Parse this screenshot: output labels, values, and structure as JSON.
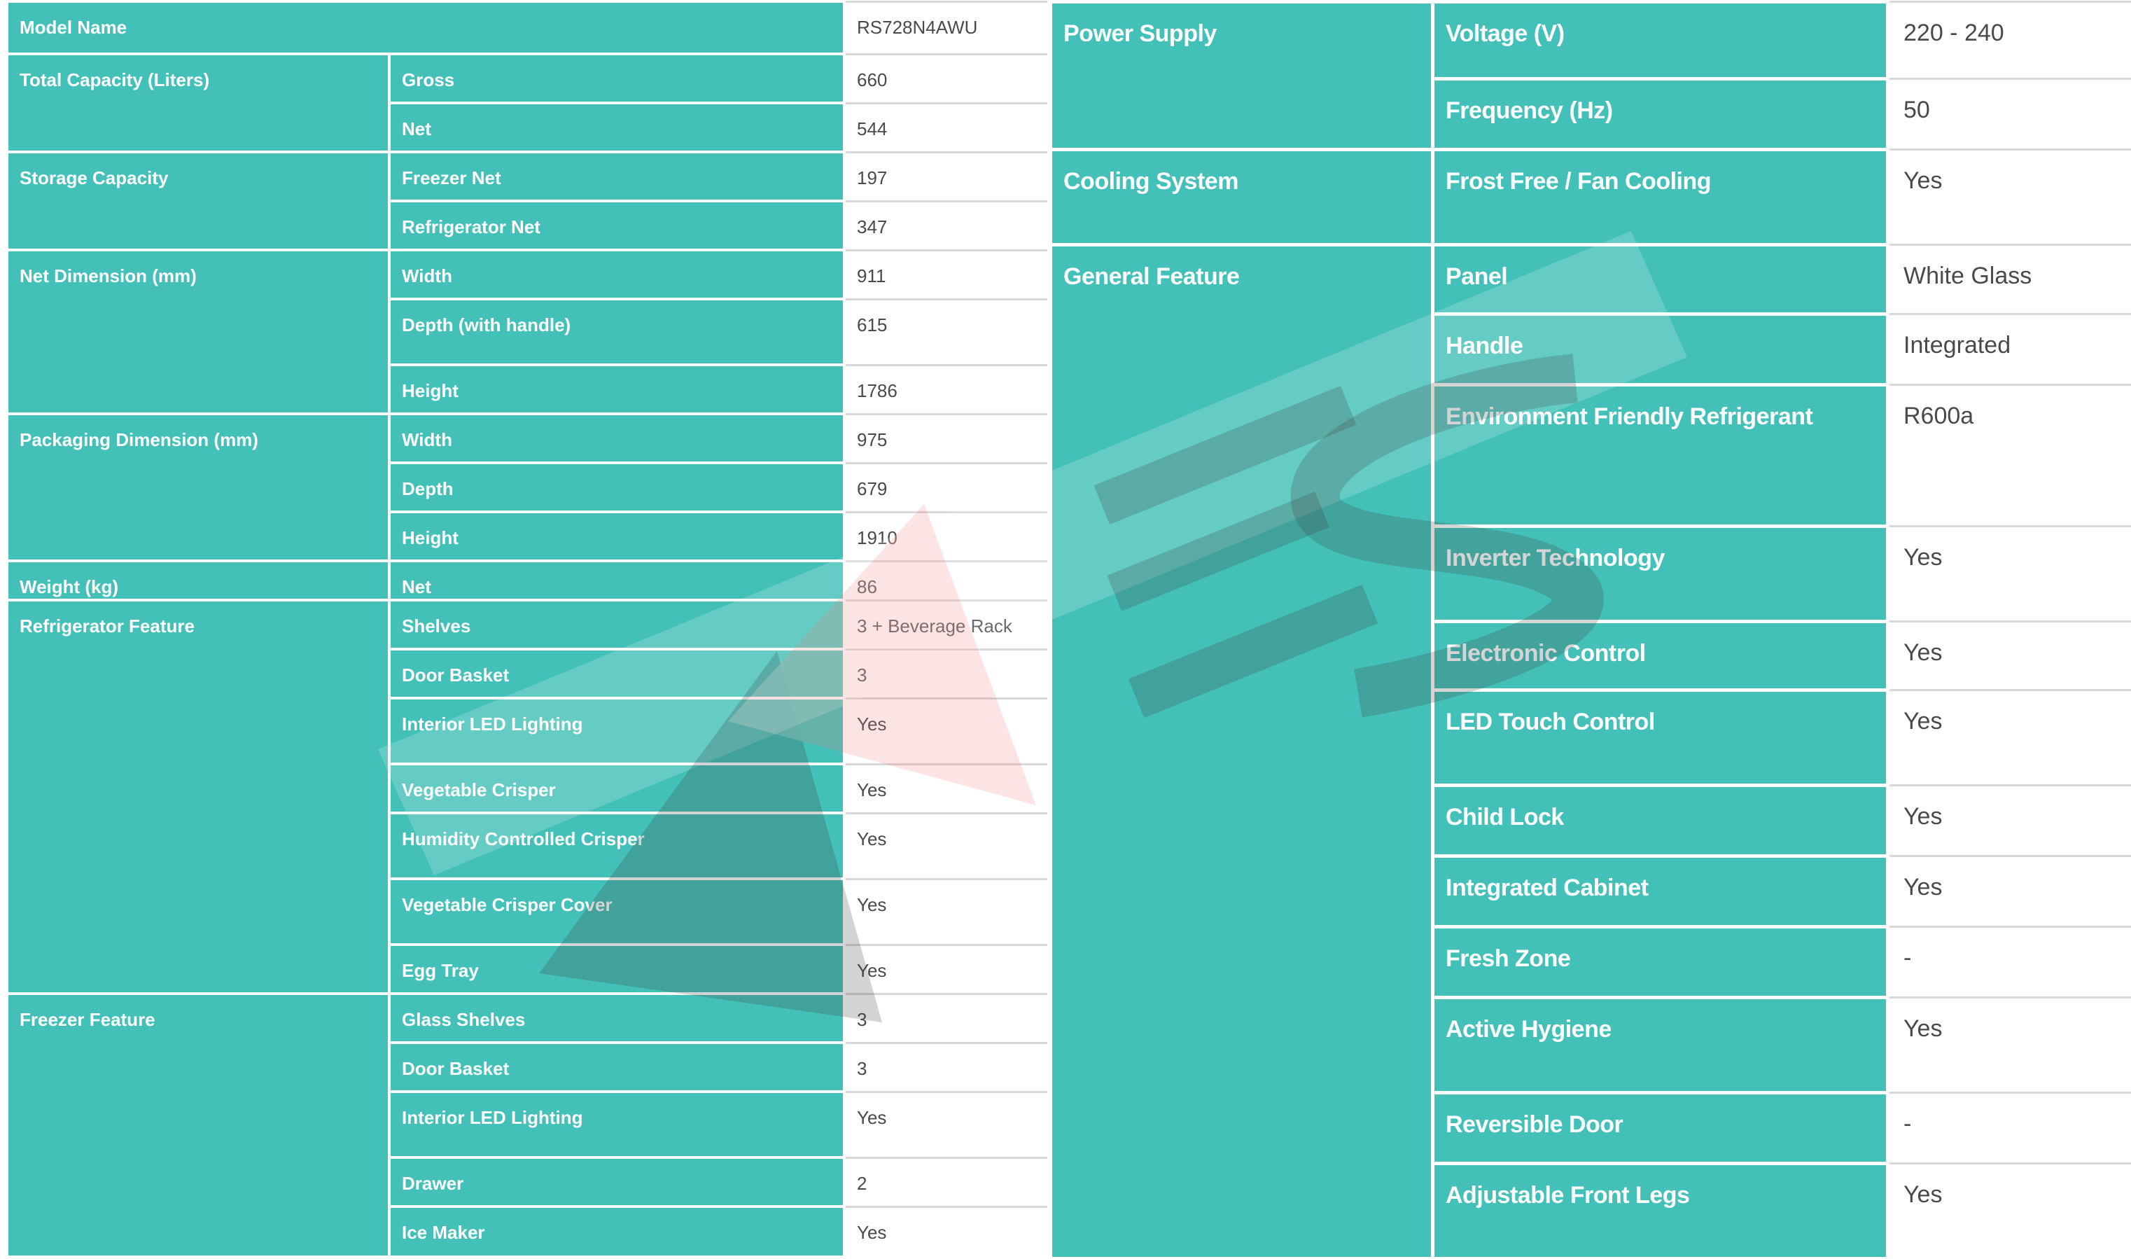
{
  "left_table": {
    "groups": [
      {
        "category": "Model Name",
        "rows": [
          {
            "attribute": "",
            "value": "RS728N4AWU"
          }
        ]
      },
      {
        "category": "Total Capacity (Liters)",
        "rows": [
          {
            "attribute": "Gross",
            "value": "660"
          },
          {
            "attribute": "Net",
            "value": "544"
          }
        ]
      },
      {
        "category": "Storage Capacity",
        "rows": [
          {
            "attribute": "Freezer Net",
            "value": "197"
          },
          {
            "attribute": "Refrigerator Net",
            "value": "347"
          }
        ]
      },
      {
        "category": "Net Dimension (mm)",
        "rows": [
          {
            "attribute": "Width",
            "value": "911"
          },
          {
            "attribute": "Depth (with handle)",
            "value": "615"
          },
          {
            "attribute": "Height",
            "value": "1786"
          }
        ]
      },
      {
        "category": "Packaging Dimension (mm)",
        "rows": [
          {
            "attribute": "Width",
            "value": "975"
          },
          {
            "attribute": "Depth",
            "value": "679"
          },
          {
            "attribute": "Height",
            "value": "1910"
          }
        ]
      },
      {
        "category": "Weight (kg)",
        "rows": [
          {
            "attribute": "Net",
            "value": "86"
          }
        ]
      },
      {
        "category": "Refrigerator Feature",
        "rows": [
          {
            "attribute": "Shelves",
            "value": "3 + Beverage Rack"
          },
          {
            "attribute": "Door Basket",
            "value": "3"
          },
          {
            "attribute": "Interior LED Lighting",
            "value": "Yes"
          },
          {
            "attribute": "Vegetable Crisper",
            "value": "Yes"
          },
          {
            "attribute": "Humidity Controlled Crisper",
            "value": "Yes"
          },
          {
            "attribute": "Vegetable Crisper Cover",
            "value": "Yes"
          },
          {
            "attribute": "Egg Tray",
            "value": "Yes"
          }
        ]
      },
      {
        "category": "Freezer Feature",
        "rows": [
          {
            "attribute": "Glass Shelves",
            "value": "3"
          },
          {
            "attribute": "Door Basket",
            "value": "3"
          },
          {
            "attribute": "Interior LED Lighting",
            "value": "Yes"
          },
          {
            "attribute": "Drawer",
            "value": "2"
          },
          {
            "attribute": "Ice Maker",
            "value": "Yes"
          }
        ]
      }
    ]
  },
  "right_table": {
    "groups": [
      {
        "category": "Power Supply",
        "rows": [
          {
            "attribute": "Voltage (V)",
            "value": "220 - 240"
          },
          {
            "attribute": "Frequency (Hz)",
            "value": "50"
          }
        ]
      },
      {
        "category": "Cooling System",
        "rows": [
          {
            "attribute": "Frost Free / Fan Cooling",
            "value": "Yes"
          }
        ]
      },
      {
        "category": "General Feature",
        "rows": [
          {
            "attribute": "Panel",
            "value": "White Glass"
          },
          {
            "attribute": "Handle",
            "value": "Integrated"
          },
          {
            "attribute": "Environment Friendly Refrigerant",
            "value": "R600a"
          },
          {
            "attribute": "Inverter Technology",
            "value": "Yes"
          },
          {
            "attribute": "Electronic Control",
            "value": "Yes"
          },
          {
            "attribute": "LED Touch Control",
            "value": "Yes"
          },
          {
            "attribute": "Child Lock",
            "value": "Yes"
          },
          {
            "attribute": "Integrated Cabinet",
            "value": "Yes"
          },
          {
            "attribute": "Fresh Zone",
            "value": "-"
          },
          {
            "attribute": "Active Hygiene",
            "value": "Yes"
          },
          {
            "attribute": "Reversible Door",
            "value": "-"
          },
          {
            "attribute": "Adjustable Front Legs",
            "value": "Yes"
          }
        ]
      }
    ]
  },
  "colors": {
    "teal": "#43c1b8",
    "value_text": "#4a4a4a",
    "watermark_red": "#f27a7a"
  },
  "watermark": {
    "text": "AES"
  }
}
